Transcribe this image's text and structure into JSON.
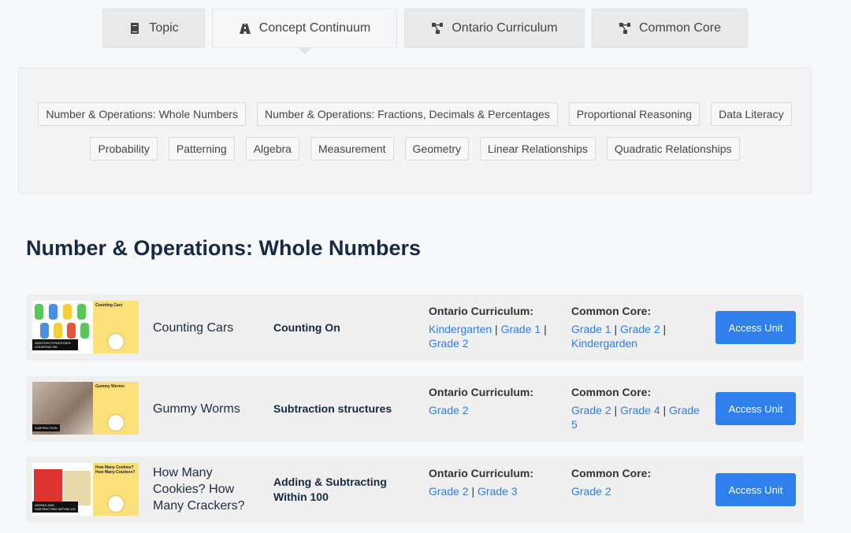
{
  "tabs": [
    {
      "label": "Topic",
      "icon": "book-icon",
      "active": false
    },
    {
      "label": "Concept Continuum",
      "icon": "road-icon",
      "active": true
    },
    {
      "label": "Ontario Curriculum",
      "icon": "sitemap-icon",
      "active": false
    },
    {
      "label": "Common Core",
      "icon": "sitemap-icon",
      "active": false
    }
  ],
  "tags_row1": [
    "Number & Operations: Whole Numbers",
    "Number & Operations: Fractions, Decimals & Percentages",
    "Proportional Reasoning",
    "Data Literacy"
  ],
  "tags_row2": [
    "Probability",
    "Patterning",
    "Algebra",
    "Measurement",
    "Geometry",
    "Linear Relationships",
    "Quadratic Relationships"
  ],
  "section_title": "Number & Operations: Whole Numbers",
  "ontario_label": "Ontario Curriculum:",
  "cc_label": "Common Core:",
  "button_label": "Access Unit",
  "colors": {
    "accent": "#2f80ed",
    "link": "#2f7ee6",
    "heading": "#172a45",
    "thumb_yellow": "#fbe07a"
  },
  "units": [
    {
      "title": "Counting Cars",
      "concept": "Counting On",
      "thumb_title": "Counting Cars",
      "thumb_badge": "ADDITION STRATEGIES: COUNTING ON",
      "ontario": [
        "Kindergarten",
        "Grade 1",
        "Grade 2"
      ],
      "common_core": [
        "Grade 1",
        "Grade 2",
        "Kindergarden"
      ]
    },
    {
      "title": "Gummy Worms",
      "concept": "Subtraction structures",
      "thumb_title": "Gummy Worms",
      "thumb_badge": "SUBTRACTION",
      "ontario": [
        "Grade 2"
      ],
      "common_core": [
        "Grade 2",
        "Grade 4",
        "Grade 5"
      ]
    },
    {
      "title": "How Many Cookies? How Many Crackers?",
      "concept": "Adding & Subtracting Within 100",
      "thumb_title": "How Many Cookies? How Many Crackers?",
      "thumb_badge": "ADDING AND SUBTRACTING WITHIN 100",
      "ontario": [
        "Grade 2",
        "Grade 3"
      ],
      "common_core": [
        "Grade 2"
      ]
    }
  ]
}
